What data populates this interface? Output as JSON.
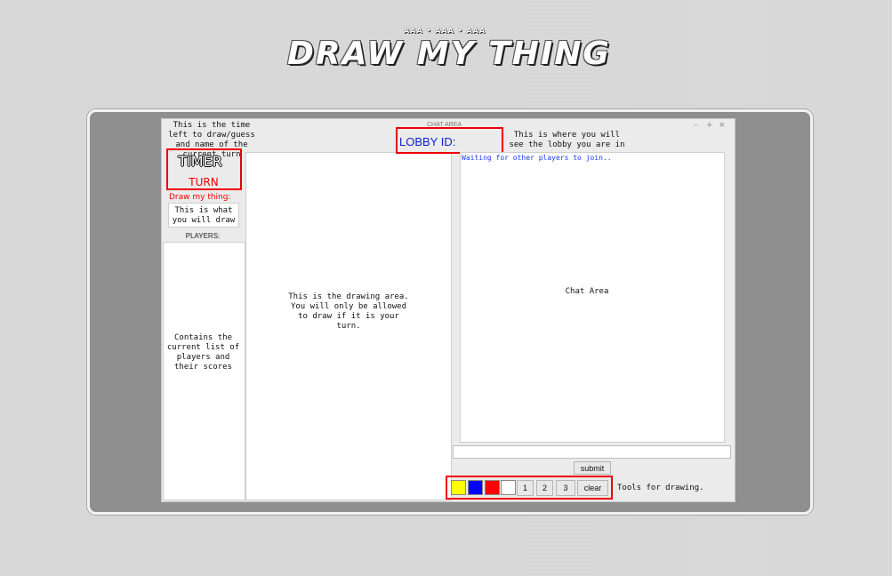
{
  "header": {
    "subtitle": "AAA • AAA • AAA",
    "logo": "DRAW MY THING"
  },
  "window": {
    "title": "CHAT AREA",
    "controls": [
      "–",
      "+",
      "×"
    ]
  },
  "left": {
    "timer_note": "This is the time left to draw/guess and name of the current turn",
    "timer": "TIMER",
    "turn": "TURN",
    "draw_label": "Draw my thing:",
    "word_note": "This is what you will draw",
    "players_label": "PLAYERS:",
    "players_note": "Contains the current list of players and their scores"
  },
  "canvas": {
    "note": "This is the drawing area. You will only be allowed to draw if it is your turn."
  },
  "lobby": {
    "label": "LOBBY ID:",
    "note": "This is where you will see the lobby you are in"
  },
  "chat": {
    "status": "Waiting for other players to join..",
    "note": "Chat Area",
    "input_value": "",
    "submit_label": "submit"
  },
  "tools": {
    "colors": [
      {
        "name": "yellow",
        "hex": "#ffff00"
      },
      {
        "name": "blue",
        "hex": "#0000ff"
      },
      {
        "name": "red",
        "hex": "#ff0000"
      },
      {
        "name": "white",
        "hex": "#ffffff"
      }
    ],
    "sizes": [
      "1",
      "2",
      "3"
    ],
    "clear_label": "clear",
    "note": "Tools for drawing."
  },
  "colors": {
    "annotation_red": "#e00000",
    "lobby_blue": "#1020d0"
  }
}
